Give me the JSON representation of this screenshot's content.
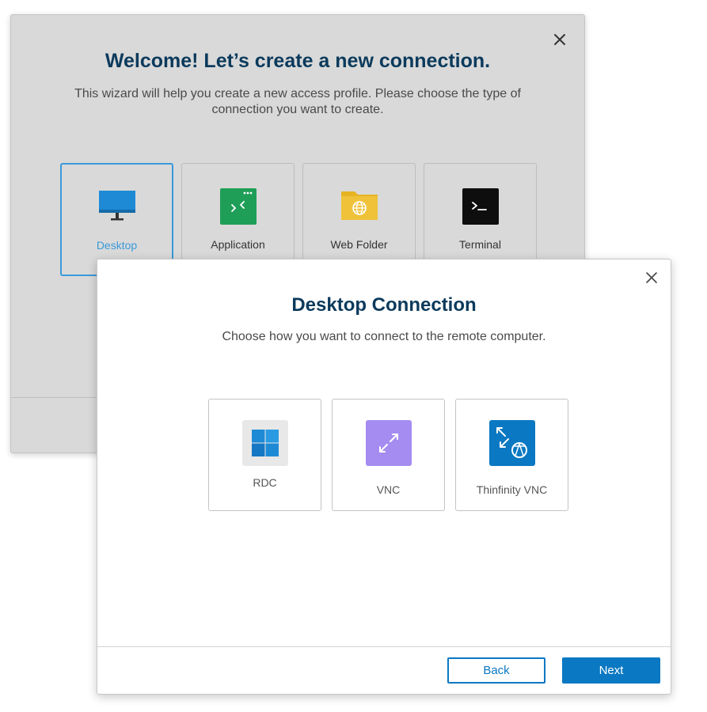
{
  "welcome_dialog": {
    "title": "Welcome! Let’s create a new connection.",
    "subtitle": "This wizard will help you create a new access profile. Please choose the type of connection you want to create.",
    "close_icon": "close-icon",
    "selected_type": "Desktop",
    "types": [
      {
        "label": "Desktop",
        "icon": "monitor-icon",
        "color": "#1e8ad6"
      },
      {
        "label": "Application",
        "icon": "application-icon",
        "color": "#1f9e57"
      },
      {
        "label": "Web Folder",
        "icon": "web-folder-icon",
        "color": "#e6b323"
      },
      {
        "label": "Terminal",
        "icon": "terminal-icon",
        "color": "#111111"
      }
    ]
  },
  "desktop_dialog": {
    "title": "Desktop Connection",
    "subtitle": "Choose how you want to connect to the remote computer.",
    "close_icon": "close-icon",
    "methods": [
      {
        "label": "RDC",
        "icon": "windows-logo-icon",
        "color": "#e8e8e8"
      },
      {
        "label": "VNC",
        "icon": "vnc-arrows-icon",
        "color": "#a58cf0"
      },
      {
        "label": "Thinfinity VNC",
        "icon": "thinfinity-vnc-icon",
        "color": "#0a78c2"
      }
    ],
    "back_label": "Back",
    "next_label": "Next",
    "accent_color": "#0a78c2"
  }
}
